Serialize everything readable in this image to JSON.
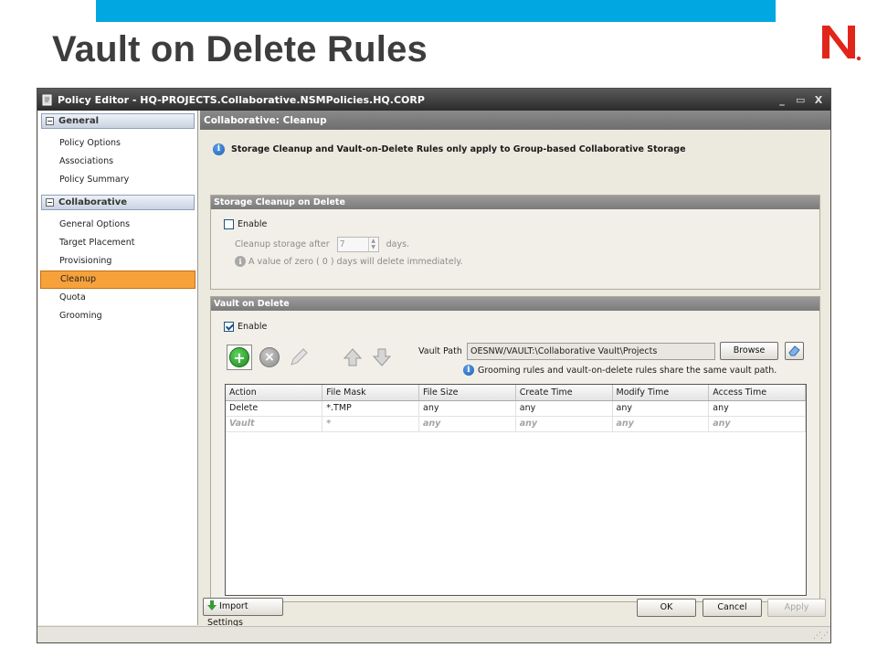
{
  "slide": {
    "title": "Vault on Delete Rules",
    "accent_color": "#00a7e1",
    "logo": "N"
  },
  "window": {
    "title": "Policy Editor - HQ-PROJECTS.Collaborative.NSMPolicies.HQ.CORP",
    "controls": [
      "_",
      "▭",
      "X"
    ]
  },
  "sidebar": {
    "general": {
      "header": "General",
      "items": [
        "Policy Options",
        "Associations",
        "Policy Summary"
      ]
    },
    "collaborative": {
      "header": "Collaborative",
      "items": [
        "General Options",
        "Target Placement",
        "Provisioning",
        "Cleanup",
        "Quota",
        "Grooming"
      ],
      "active": "Cleanup"
    },
    "highlight_color": "#f7a13b"
  },
  "content": {
    "header": "Collaborative: Cleanup",
    "info": "Storage Cleanup and Vault-on-Delete Rules only apply to Group-based Collaborative Storage",
    "cleanup": {
      "title": "Storage Cleanup on Delete",
      "enable_label": "Enable",
      "enabled": false,
      "after_label": "Cleanup storage after",
      "after_value": "7",
      "after_unit": "days.",
      "note": "A value of zero ( 0 ) days will delete immediately."
    },
    "vault": {
      "title": "Vault on Delete",
      "enable_label": "Enable",
      "enabled": true,
      "path_label": "Vault Path",
      "path_value": "OESNW/VAULT:\\Collaborative Vault\\Projects",
      "browse_label": "Browse",
      "path_note": "Grooming rules and vault-on-delete rules share the same vault path.",
      "columns": [
        "Action",
        "File Mask",
        "File Size",
        "Create Time",
        "Modify Time",
        "Access Time"
      ],
      "rows": [
        [
          "Delete",
          "*.TMP",
          "any",
          "any",
          "any",
          "any"
        ],
        [
          "Vault",
          "*",
          "any",
          "any",
          "any",
          "any"
        ]
      ]
    }
  },
  "footer": {
    "import_label": "Import Settings",
    "ok_label": "OK",
    "cancel_label": "Cancel",
    "apply_label": "Apply"
  }
}
